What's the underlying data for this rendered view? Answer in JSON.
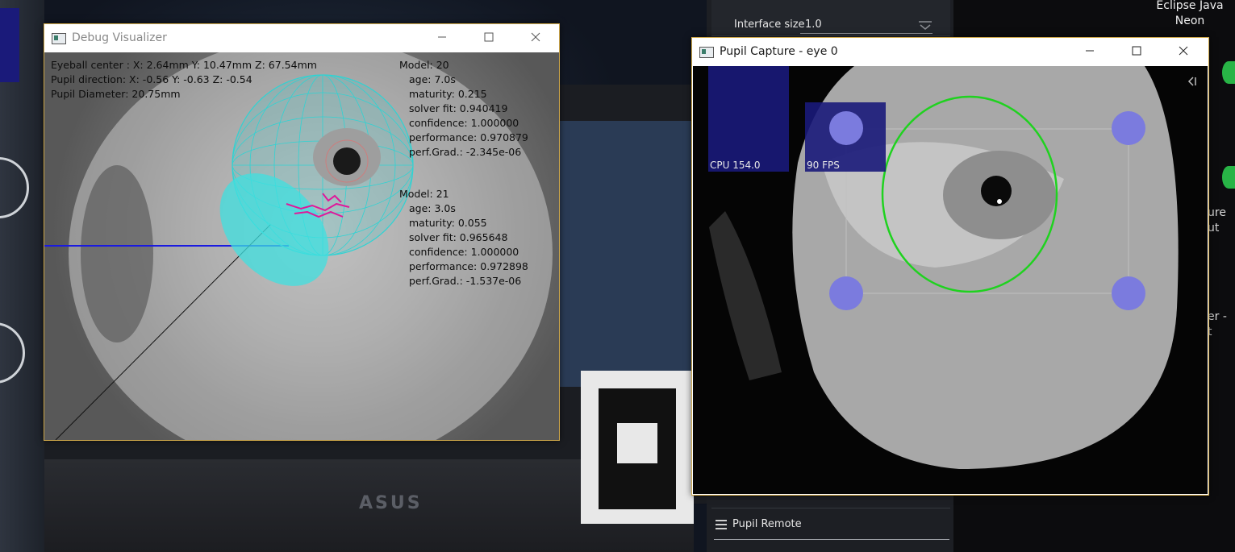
{
  "background": {
    "brand_text": "ASUS",
    "settings_panel": {
      "interface_size_label": "Interface size",
      "interface_size_value": "1.0",
      "pupil_remote_label": "Pupil Remote"
    },
    "desktop": {
      "eclipse_label": "Eclipse Java\nNeon",
      "fragment_1": "ure",
      "fragment_2": "ut",
      "fragment_3": "er -",
      "fragment_4": "t"
    }
  },
  "debug_window": {
    "title": "Debug Visualizer",
    "eyeball_center": "Eyeball center : X: 2.64mm Y: 10.47mm Z: 67.54mm",
    "pupil_direction": "Pupil direction:  X: -0.56 Y: -0.63 Z: -0.54",
    "pupil_diameter": "Pupil Diameter: 20.75mm",
    "models": [
      {
        "header": "Model: 20",
        "age": "age: 7.0s",
        "maturity": "maturity: 0.215",
        "solver_fit": "solver fit: 0.940419",
        "confidence": "confidence: 1.000000",
        "performance": "performance: 0.970879",
        "perf_grad": "perf.Grad.: -2.345e-06"
      },
      {
        "header": "Model: 21",
        "age": "age: 3.0s",
        "maturity": "maturity: 0.055",
        "solver_fit": "solver fit: 0.965648",
        "confidence": "confidence: 1.000000",
        "performance": "performance: 0.972898",
        "perf_grad": "perf.Grad.: -1.537e-06"
      }
    ]
  },
  "pupil_window": {
    "title": "Pupil Capture - eye 0",
    "cpu_label": "CPU 154.0",
    "fps_label": "90 FPS"
  },
  "colors": {
    "pupil_ellipse": "#1fd21f",
    "roi_handle": "#7b7bde",
    "eyeball_mesh": "#2fd3d3",
    "graph_bar": "#1a1a7a",
    "window_border": "#cfa84a"
  },
  "icons": {
    "minimize": "minimize-icon",
    "maximize": "maximize-icon",
    "close": "close-icon",
    "menu": "hamburger-menu-icon",
    "collapse": "collapse-sidebar-icon"
  }
}
